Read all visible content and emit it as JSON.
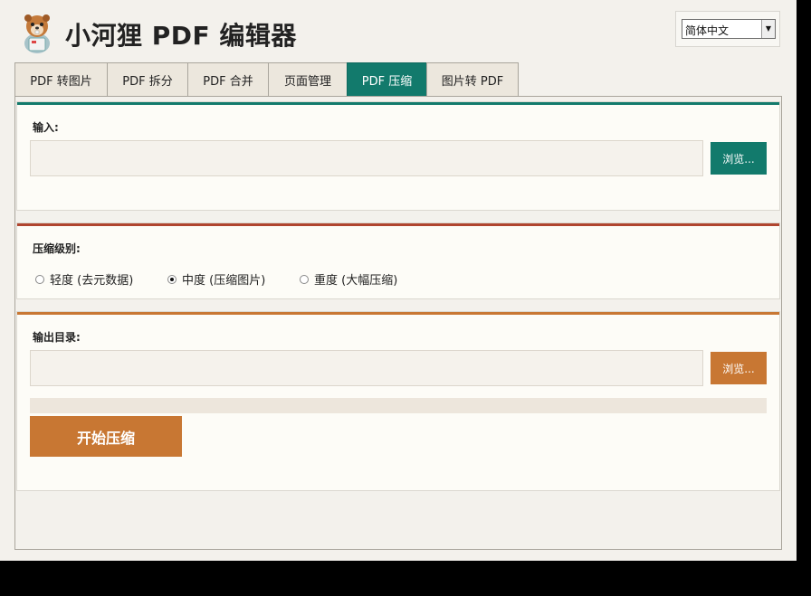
{
  "app": {
    "title": "小河狸 PDF 编辑器"
  },
  "language": {
    "selected": "简体中文"
  },
  "tabs": [
    {
      "label": "PDF 转图片"
    },
    {
      "label": "PDF 拆分"
    },
    {
      "label": "PDF 合并"
    },
    {
      "label": "页面管理"
    },
    {
      "label": "PDF 压缩"
    },
    {
      "label": "图片转 PDF"
    }
  ],
  "input_section": {
    "label": "输入:",
    "value": "",
    "browse_label": "浏览..."
  },
  "compression_section": {
    "label": "压缩级别:",
    "options": [
      {
        "label": "轻度 (去元数据)",
        "selected": false
      },
      {
        "label": "中度 (压缩图片)",
        "selected": true
      },
      {
        "label": "重度 (大幅压缩)",
        "selected": false
      }
    ]
  },
  "output_section": {
    "label": "输出目录:",
    "value": "",
    "browse_label": "浏览...",
    "progress": 0,
    "start_label": "开始压缩"
  },
  "colors": {
    "teal": "#127a6c",
    "red": "#b0452f",
    "orange": "#c87733"
  }
}
